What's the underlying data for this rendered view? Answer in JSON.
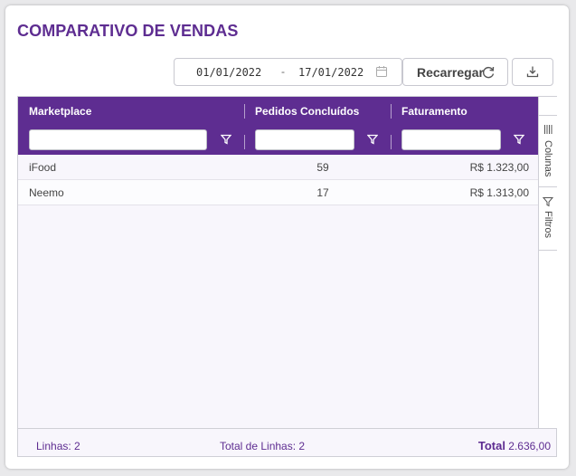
{
  "title": "COMPARATIVO DE VENDAS",
  "date_range": {
    "start": "01/01/2022",
    "separator": "-",
    "end": "17/01/2022"
  },
  "toolbar": {
    "reload_label": "Recarregar"
  },
  "columns": [
    {
      "header": "Marketplace"
    },
    {
      "header": "Pedidos Concluídos"
    },
    {
      "header": "Faturamento"
    }
  ],
  "rows": [
    {
      "marketplace": "iFood",
      "pedidos": "59",
      "faturamento": "R$ 1.323,00"
    },
    {
      "marketplace": "Neemo",
      "pedidos": "17",
      "faturamento": "R$ 1.313,00"
    }
  ],
  "side_panel": {
    "columns_label": "Colunas",
    "filters_label": "Filtros"
  },
  "footer": {
    "rows_label": "Linhas: 2",
    "total_rows_label": "Total de Linhas: 2",
    "total_label": "Total",
    "total_value": "2.636,00"
  },
  "colors": {
    "primary": "#5e2d91",
    "background": "#f8f6fc"
  }
}
